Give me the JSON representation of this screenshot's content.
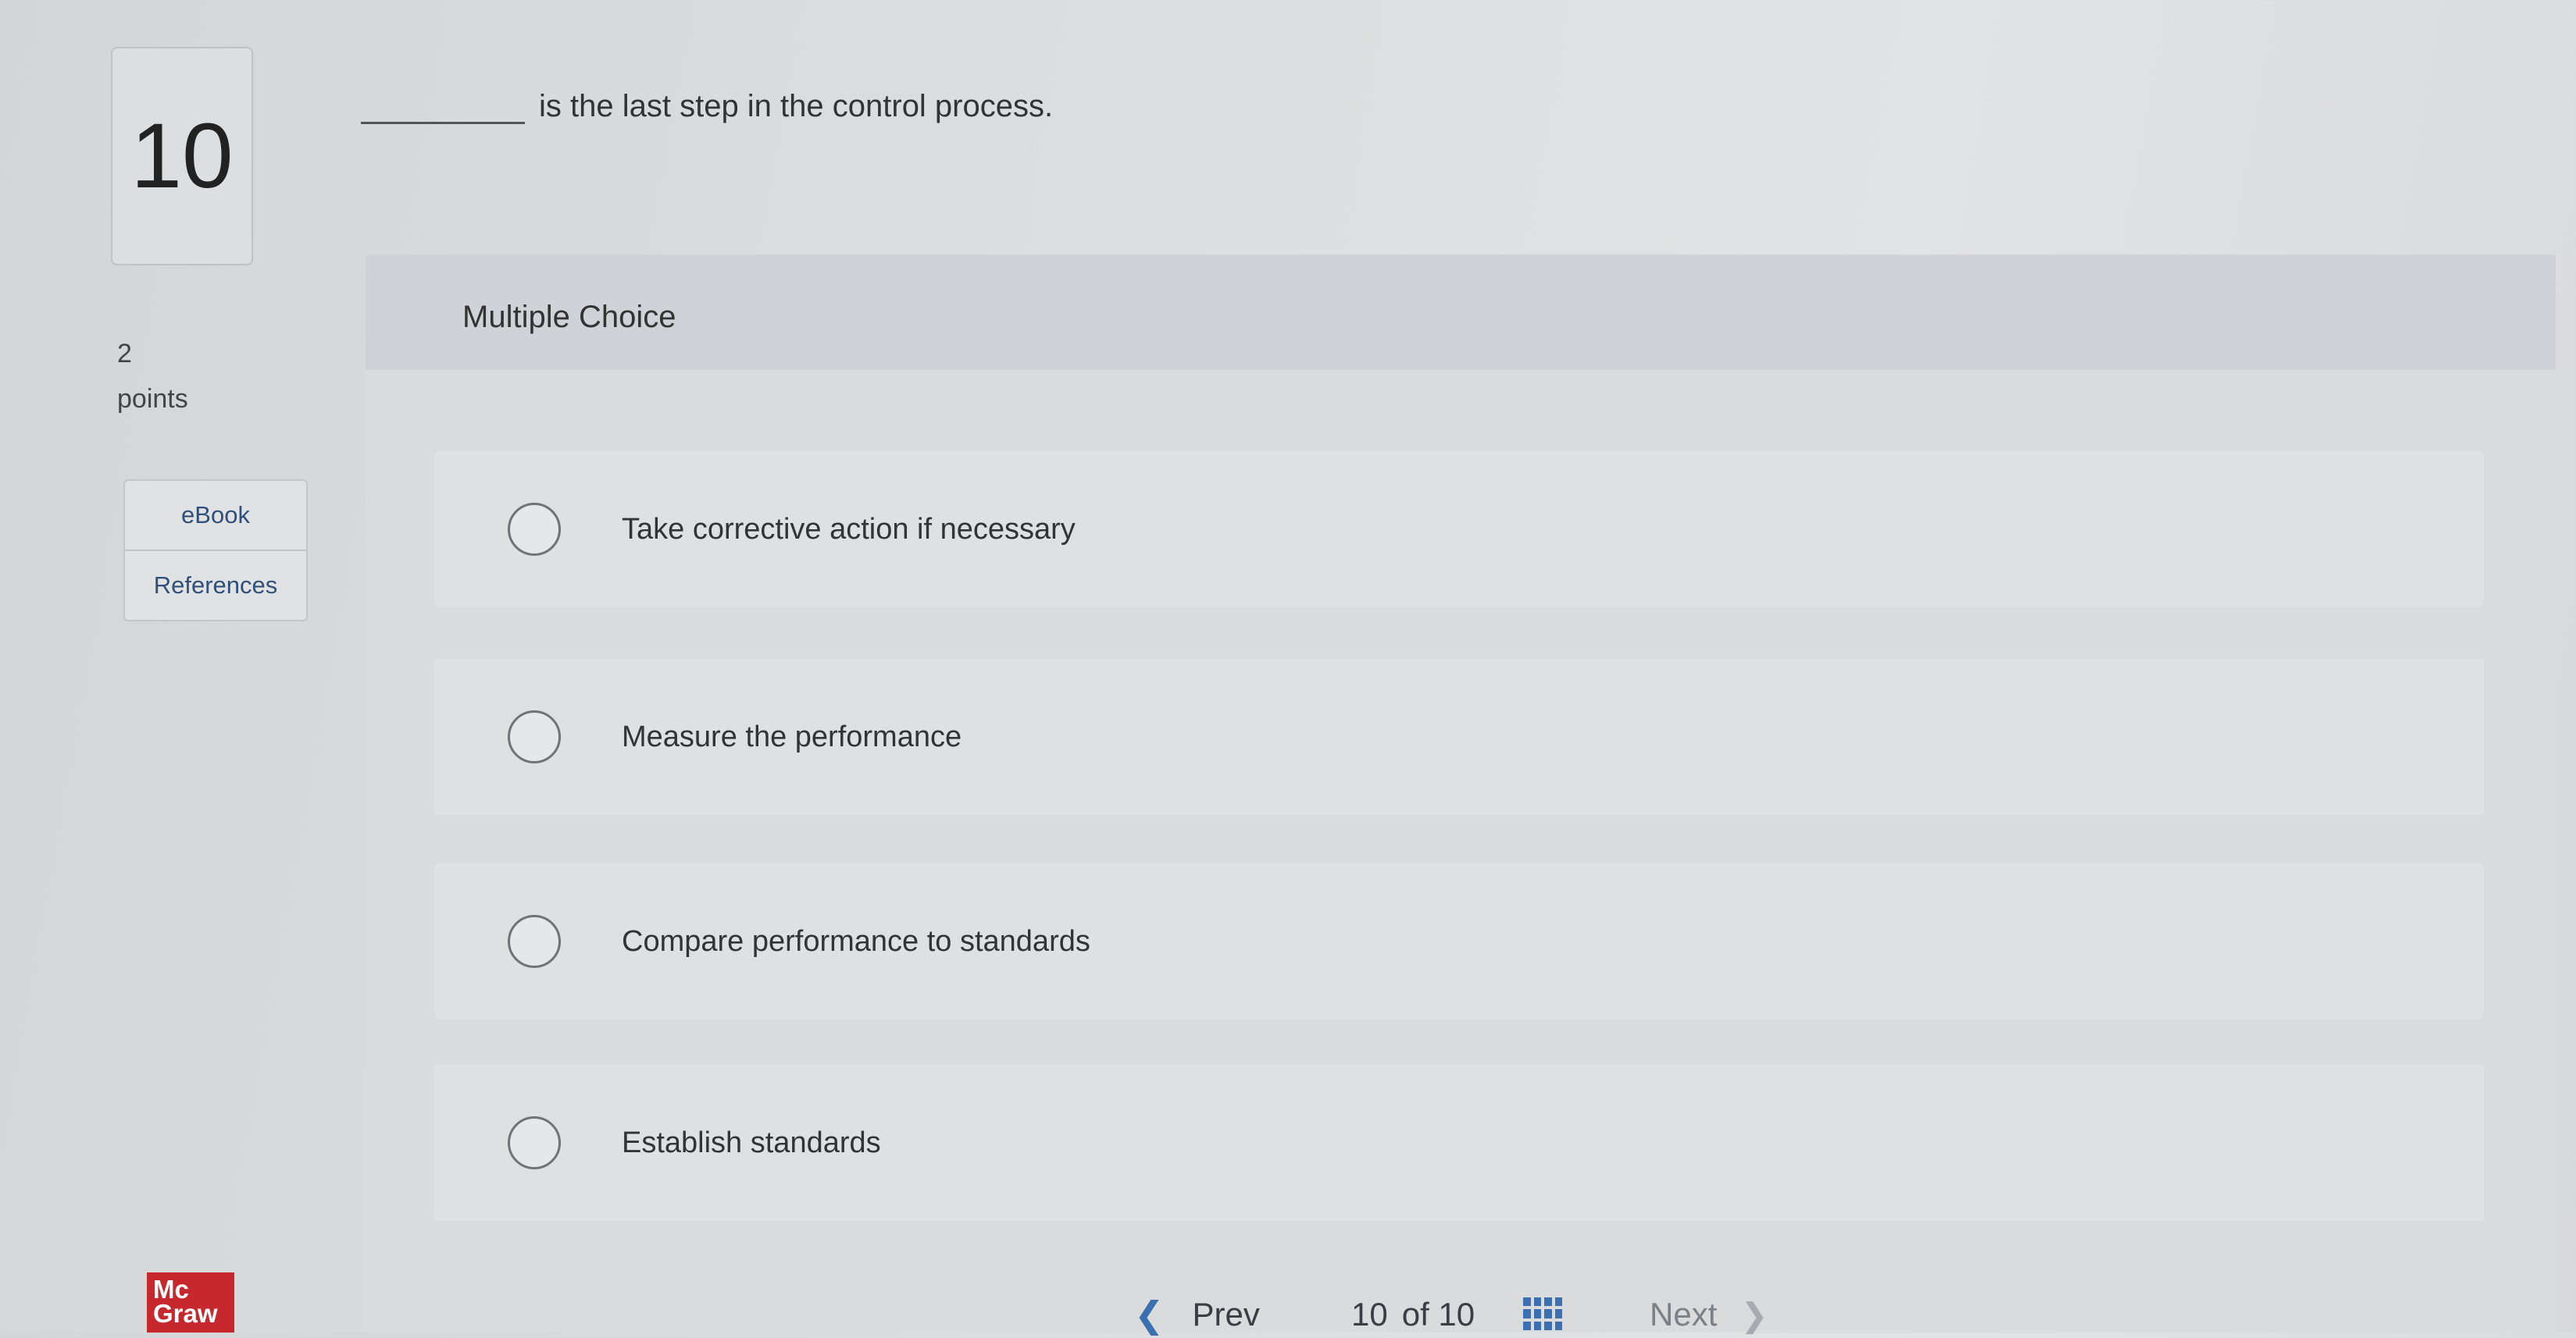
{
  "question": {
    "number": "10",
    "points_value": "2",
    "points_label": "points",
    "text": "is the last step in the control process."
  },
  "side_tabs": [
    {
      "label": "eBook"
    },
    {
      "label": "References"
    }
  ],
  "panel": {
    "type_label": "Multiple Choice"
  },
  "choices": [
    {
      "label": "Take corrective action if necessary"
    },
    {
      "label": "Measure the performance"
    },
    {
      "label": "Compare performance to standards"
    },
    {
      "label": "Establish standards"
    }
  ],
  "logo": {
    "line1": "Mc",
    "line2": "Graw"
  },
  "footer": {
    "prev_label": "Prev",
    "current_page": "10",
    "of_label": "of 10",
    "next_label": "Next"
  },
  "icons": {
    "prev": "chevron-left-icon",
    "grid": "grid-icon",
    "next": "chevron-right-icon"
  },
  "colors": {
    "link": "#30507a",
    "accent": "#3c6fb0",
    "logo_red": "#c7282e"
  }
}
